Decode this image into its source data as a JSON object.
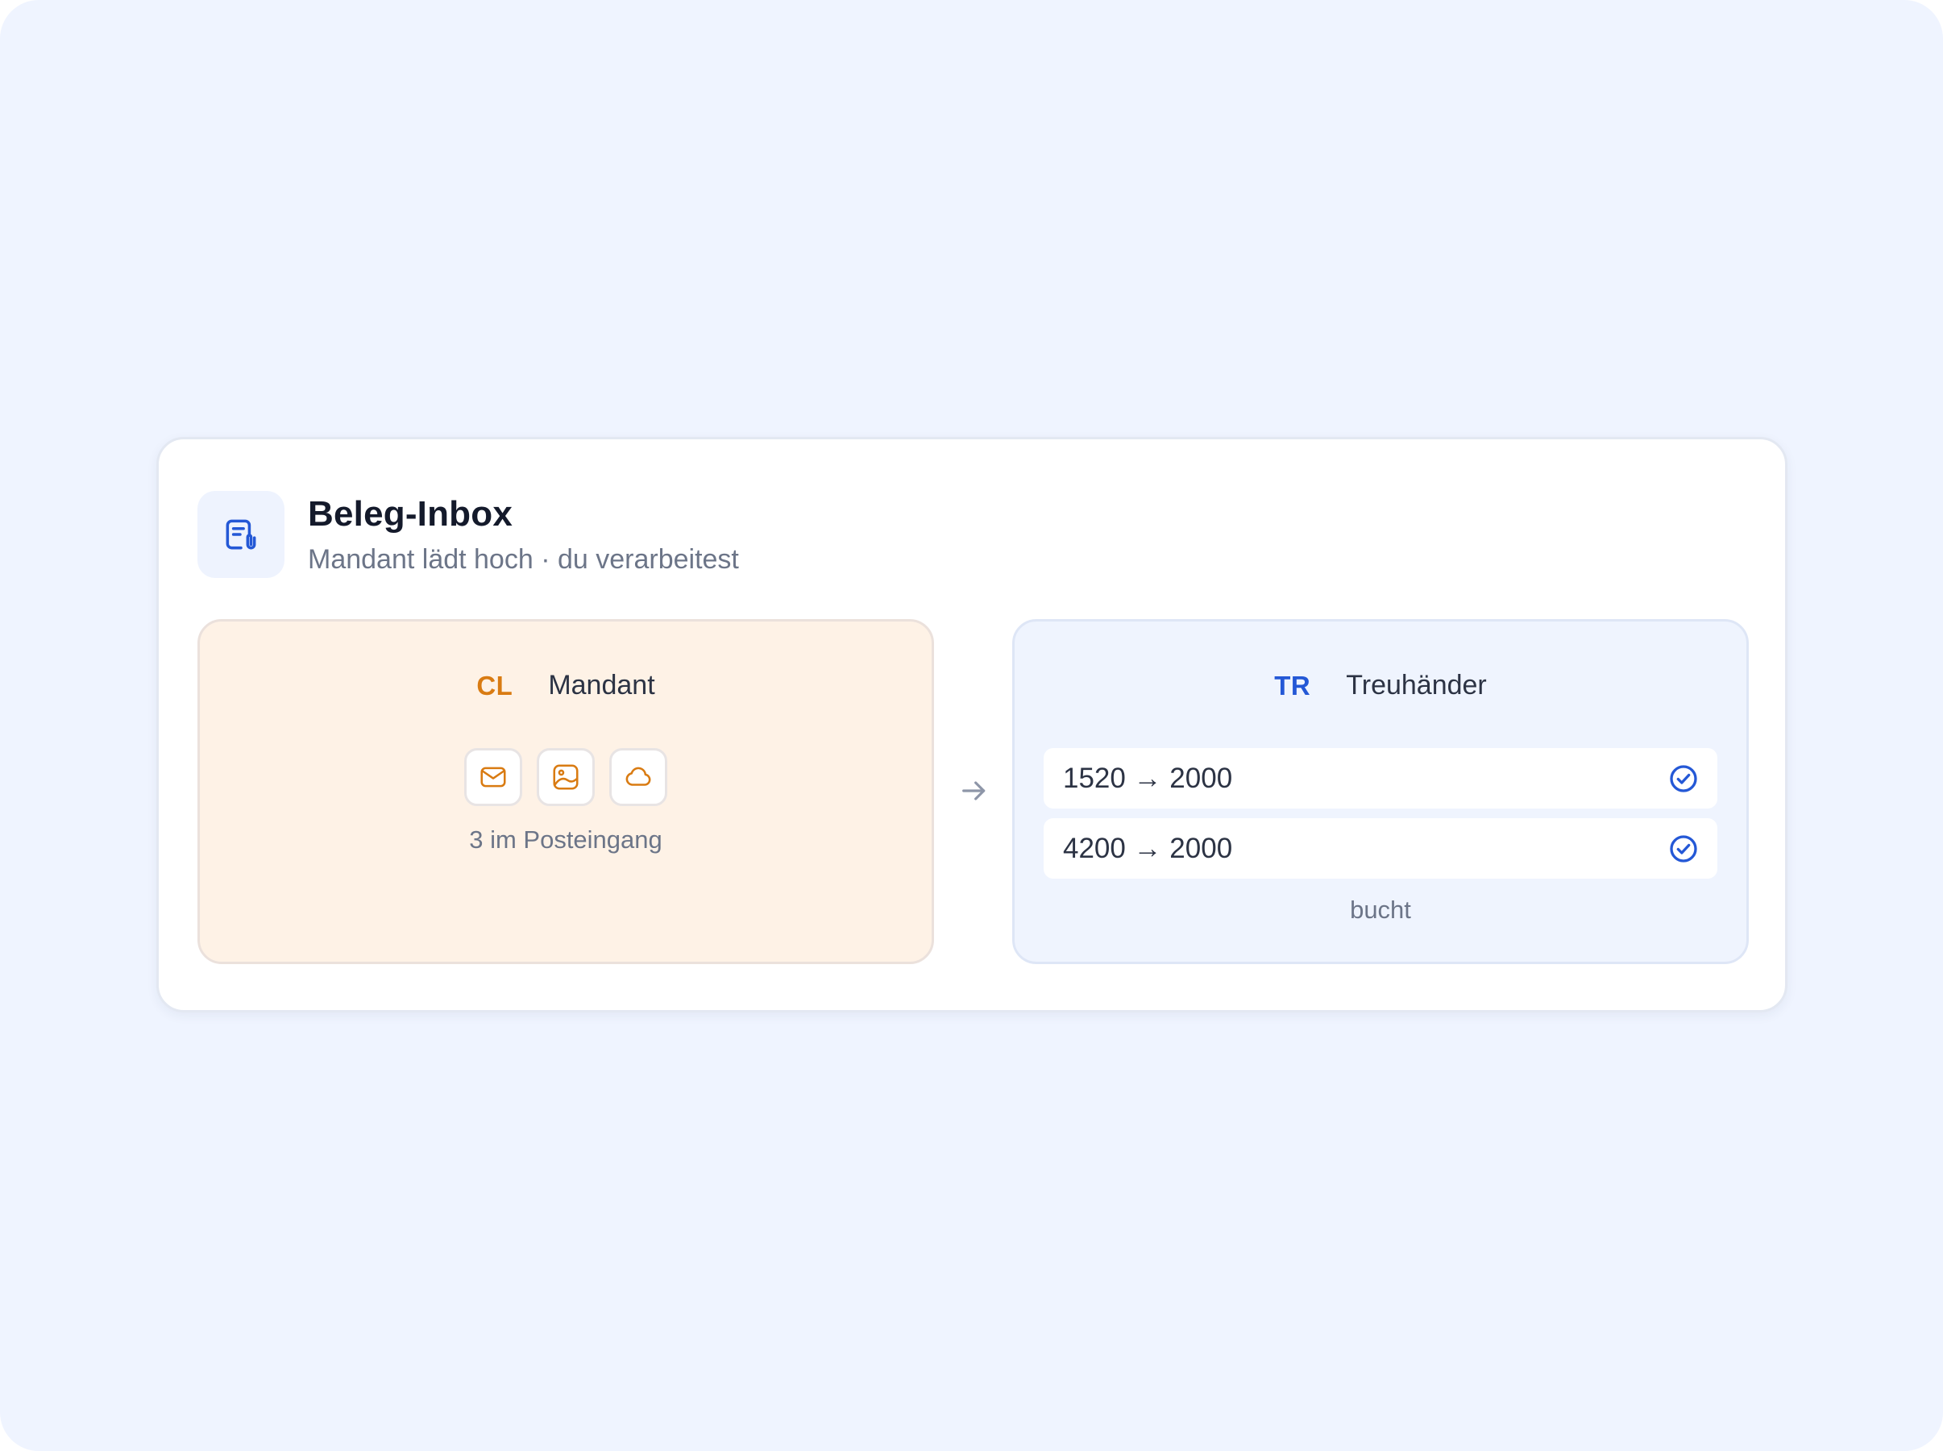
{
  "header": {
    "icon": "receipt-attachment-icon",
    "title": "Beleg-Inbox",
    "subtitle": "Mandant lädt hoch · du verarbeitest"
  },
  "client_panel": {
    "badge": "CL",
    "name": "Mandant",
    "upload_icons": [
      "mail-icon",
      "image-icon",
      "cloud-icon"
    ],
    "count_text": "3 im Posteingang"
  },
  "flow_icon": "arrow-right-icon",
  "trustee_panel": {
    "badge": "TR",
    "name": "Treuhänder",
    "rows": [
      {
        "text": "1520 → 2000",
        "icon": "check-circle-icon"
      },
      {
        "text": "4200 → 2000",
        "icon": "check-circle-icon"
      }
    ],
    "footer": "bucht"
  },
  "colors": {
    "page_background": "#eff4ff",
    "client_accent": "#d97b12",
    "client_background": "#fef2e6",
    "trustee_accent": "#2458d6",
    "trustee_background": "#eff4fe"
  }
}
